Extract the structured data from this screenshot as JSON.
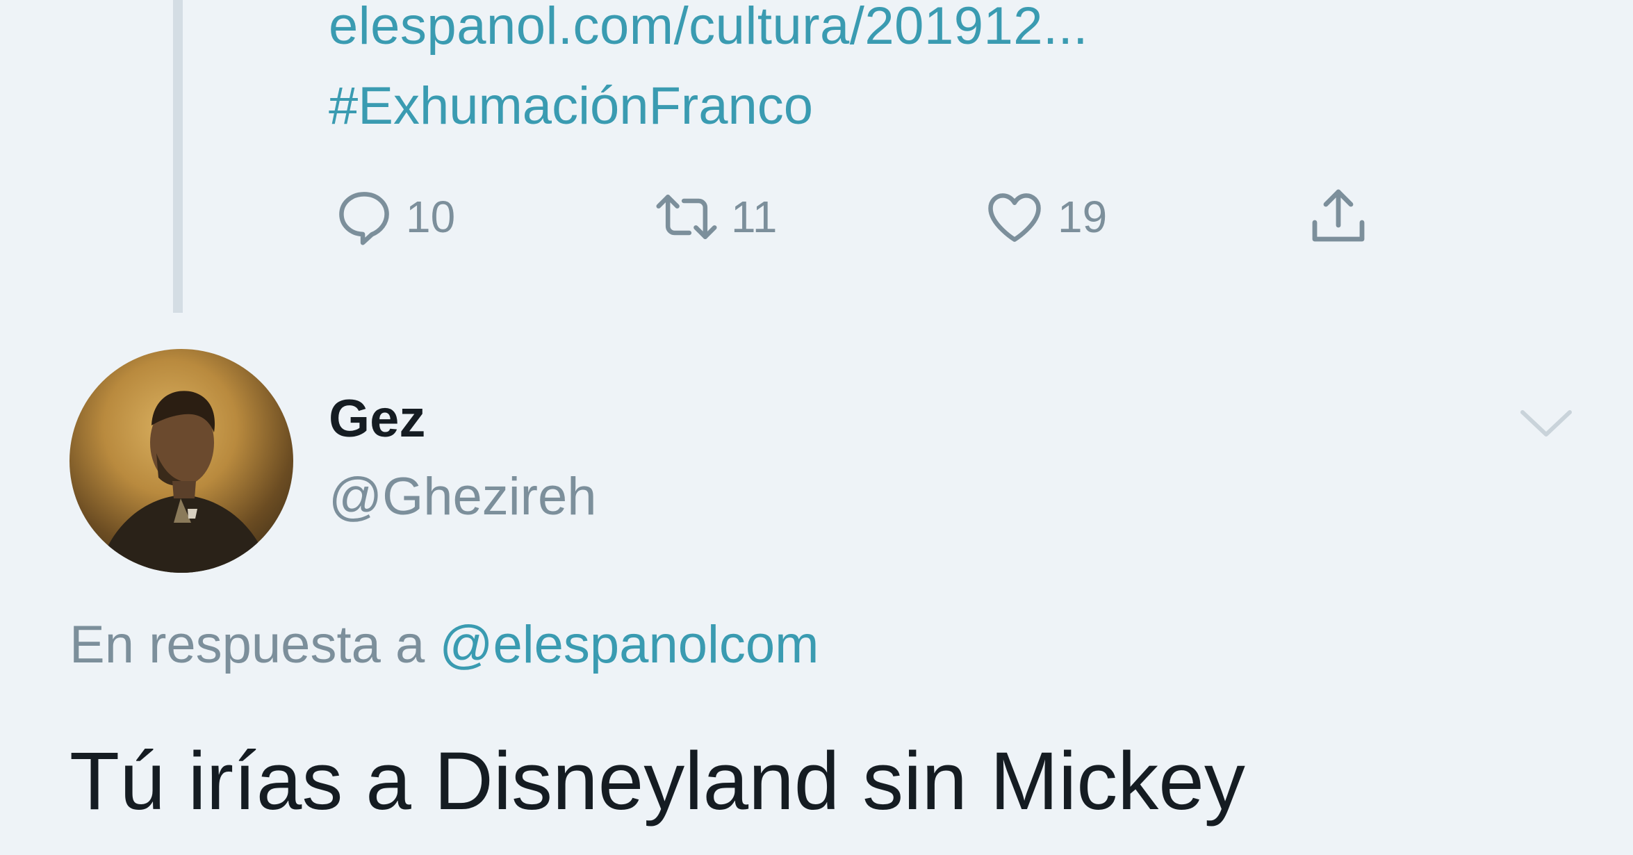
{
  "previous_tweet": {
    "link": "elespanol.com/cultura/201912...",
    "hashtag": "#ExhumaciónFranco",
    "actions": {
      "reply_icon": "reply-icon",
      "reply_count": "10",
      "retweet_icon": "retweet-icon",
      "retweet_count": "11",
      "like_icon": "heart-icon",
      "like_count": "19",
      "share_icon": "share-icon"
    }
  },
  "reply_tweet": {
    "display_name": "Gez",
    "handle": "@Ghezireh",
    "reply_prefix": "En respuesta a",
    "reply_mention": "@elespanolcom",
    "text": "Tú irías a Disneyland sin Mickey",
    "menu_icon": "chevron-down-icon"
  },
  "colors": {
    "background": "#eef3f7",
    "link": "#3a9bb1",
    "muted": "#7c8f9b",
    "text": "#151c22",
    "thread_line": "#d4dde4"
  }
}
